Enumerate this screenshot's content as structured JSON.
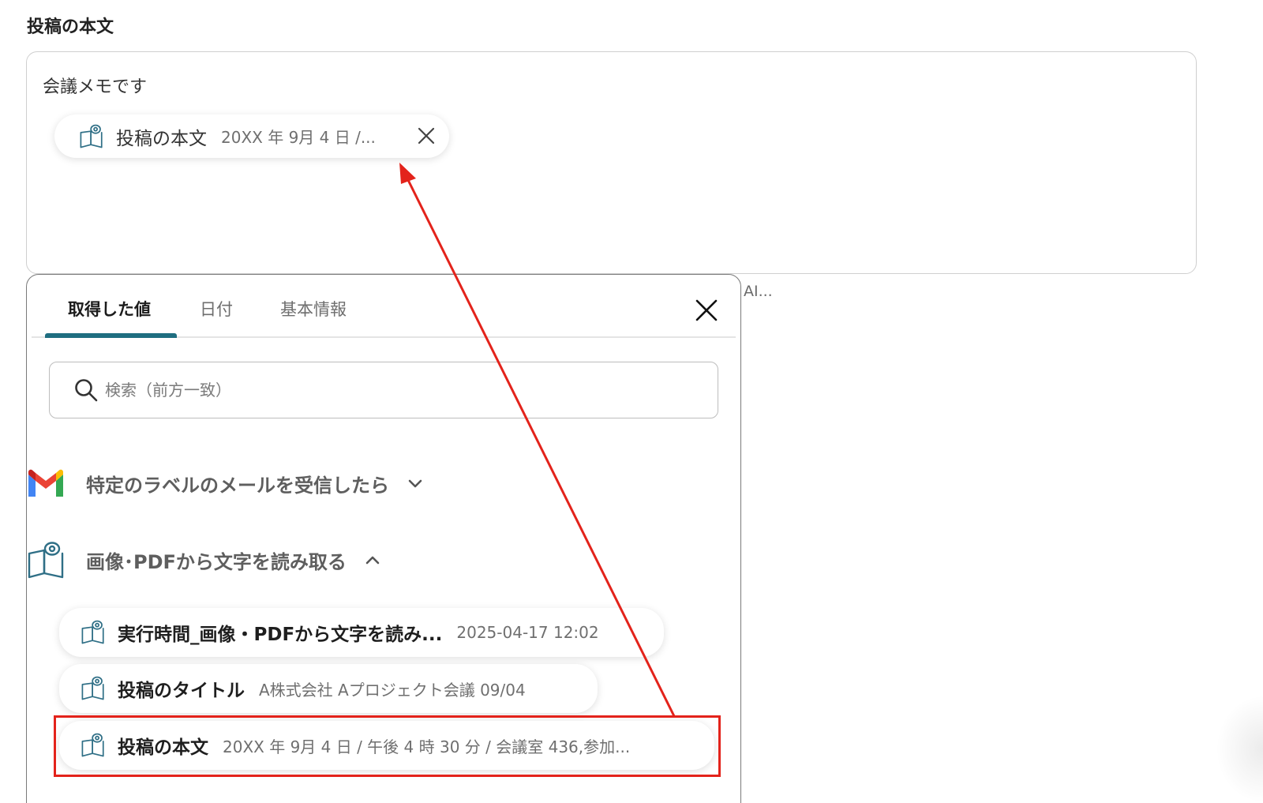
{
  "field": {
    "label": "投稿の本文",
    "editor_text": "会議メモです"
  },
  "inserted_chip": {
    "label": "投稿の本文",
    "value": "20XX 年 9月 4 日 /...",
    "icon": "ocr-book-icon"
  },
  "ai_hint": "AI...",
  "popover": {
    "tabs": [
      {
        "label": "取得した値",
        "active": true
      },
      {
        "label": "日付",
        "active": false
      },
      {
        "label": "基本情報",
        "active": false
      }
    ],
    "search": {
      "placeholder": "検索（前方一致）",
      "value": ""
    },
    "groups": [
      {
        "label": "特定のラベルのメールを受信したら",
        "icon": "gmail-icon",
        "expanded": false
      },
      {
        "label": "画像･PDFから文字を読み取る",
        "icon": "ocr-book-icon",
        "expanded": true
      }
    ],
    "items": [
      {
        "label": "実行時間_画像・PDFから文字を読み...",
        "value": "2025-04-17 12:02"
      },
      {
        "label": "投稿のタイトル",
        "value": "A株式会社 Aプロジェクト会議 09/04"
      },
      {
        "label": "投稿の本文",
        "value": "20XX 年 9月 4 日 / 午後 4 時 30 分 / 会議室 436,参加..."
      }
    ]
  },
  "colors": {
    "accent": "#1f6e80",
    "highlight": "#e3231b",
    "icon_stroke": "#2f6f86"
  }
}
